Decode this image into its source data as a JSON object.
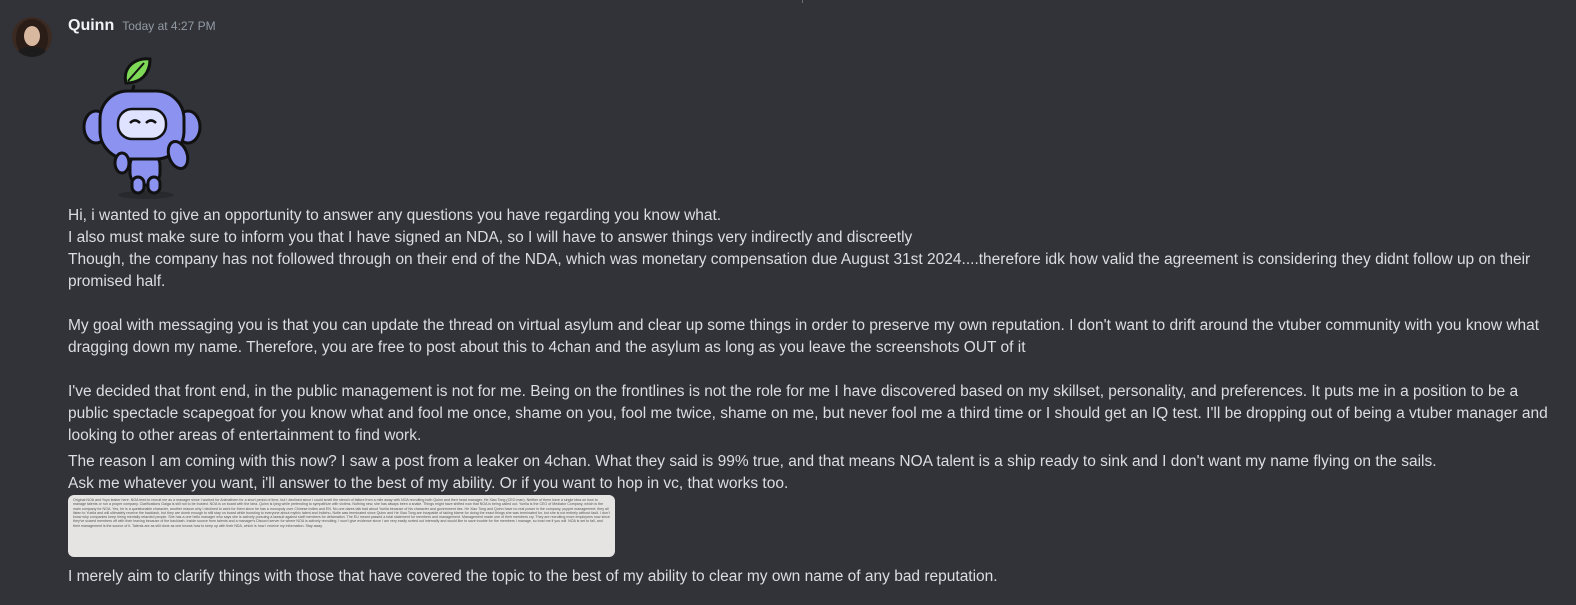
{
  "message": {
    "username": "Quinn",
    "timestamp": "Today at 4:27 PM",
    "lines": [
      "Hi, i wanted to give an opportunity to answer any questions you have regarding you know what.",
      "I also must make sure to inform you that I have signed an NDA, so I will have to answer things very indirectly and discreetly",
      "Though, the company has not followed through on their end of the NDA, which was monetary compensation due August 31st 2024....therefore idk how valid the agreement is considering they didnt follow up on their promised half.",
      "",
      "My goal with messaging you is that you can update the thread on virtual asylum and clear up some things in order to preserve my own reputation. I don't want to drift around the vtuber community with you know what dragging down my name. Therefore, you are free to post about this to 4chan and the asylum as long as you leave the screenshots OUT of it",
      "",
      "I've decided that front end, in the public management is not for me. Being on the frontlines is not the role for me I have discovered based on my skillset, personality, and preferences. It puts me in a position to be a public spectacle scapegoat for you know what and fool me once, shame on you, fool me twice, shame on me, but never fool me a third time or I should get an IQ test. I'll be dropping out of being a vtuber manager and looking to other areas of entertainment to find work.",
      "The reason I am coming with this now? I saw a post from a leaker on 4chan. What they said is 99% true, and that means NOA talent is a ship ready to sink and I don't want my name flying on the sails.",
      "Ask me whatever you want, i'll answer to the best of my ability. Or if you want to hop in vc, that works too."
    ],
    "attachment_text": "Original NOA and Yoyo leaker here. NOA tried to recruit me as a manager since I worked for Animathem for a short period of time, but I declined since I could smell the stench of failure from a mile away with NOA recruiting both Quinn and their head manager, He Xiao Tong (CEO man). Neither of them have a single idea on how to manage talents or run a proper company. Clarifications Gaiga is still not to be trusted. NOA is on board with the idea. Quinn is lying while pretending to sympathize with victims. Nothing new, she has always been a snake. Things might have shifted now that NOA is being called out. Yuella is the CEO of Mediator Company, which is the main company for NOA. Yes, he is a questionable character, another reason why I declined to work for them since he has a monopoly over Chinese indies and EN. No one dares talk bad about Yuella because of his character and government ties. He Xiao Tong and Quinn have no real power in the company, puppet management; they all listen to Yuella and will ultimately receive the backlash, but they are dumb enough to still stay on board while boosting to everyone about mythic talent and Indiehu. Nofie was terminated since Quinn and He Xiao Tong are incapable of taking blame for doing the exact things she was terminated for, but she is not entirely without fault. I don't know why companies keep hiring mentally retarded people. She has a one hello manager who says she is actively pursuing a lawsuit against staff members for defamation. The EU meant passed a total statement for members and management. Management made one of their members cry. They are recruiting more employees now since they've scared members off with their leaving because of the backlash. Inside source from talents and a manager's Discord server for where NOA is actively recruiting. I won't give evidence since I am very easily sorted out internally and would like to save trouble for the members I manage, so trust me if you will. NOA is set to fall, and their management is the source of it. Talents are as still done as one knows how to keep up with their NDA, which is how I receive my information. Stay away.",
    "final_line": "I merely aim to clarify things with those that have covered the topic to the best of my ability to clear my own name of any bad reputation.",
    "sticker": "wumpus-leaf-waving-sticker"
  },
  "colors": {
    "background": "#313338",
    "text": "#dbdee1",
    "username": "#f2f3f5",
    "timestamp": "#949ba4",
    "wumpus": "#8c92f0"
  }
}
